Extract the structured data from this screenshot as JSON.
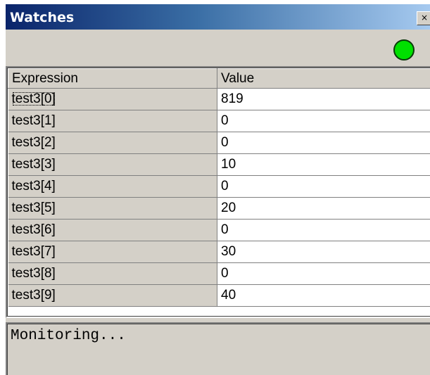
{
  "window": {
    "title": "Watches",
    "close_glyph": "×"
  },
  "status": {
    "light_color": "#00e000"
  },
  "table": {
    "columns": [
      "Expression",
      "Value"
    ],
    "rows": [
      {
        "expression": "test3[0]",
        "value": "819"
      },
      {
        "expression": "test3[1]",
        "value": "0"
      },
      {
        "expression": "test3[2]",
        "value": "0"
      },
      {
        "expression": "test3[3]",
        "value": "10"
      },
      {
        "expression": "test3[4]",
        "value": "0"
      },
      {
        "expression": "test3[5]",
        "value": "20"
      },
      {
        "expression": "test3[6]",
        "value": "0"
      },
      {
        "expression": "test3[7]",
        "value": "30"
      },
      {
        "expression": "test3[8]",
        "value": "0"
      },
      {
        "expression": "test3[9]",
        "value": "40"
      }
    ]
  },
  "output": {
    "text": "Monitoring..."
  }
}
